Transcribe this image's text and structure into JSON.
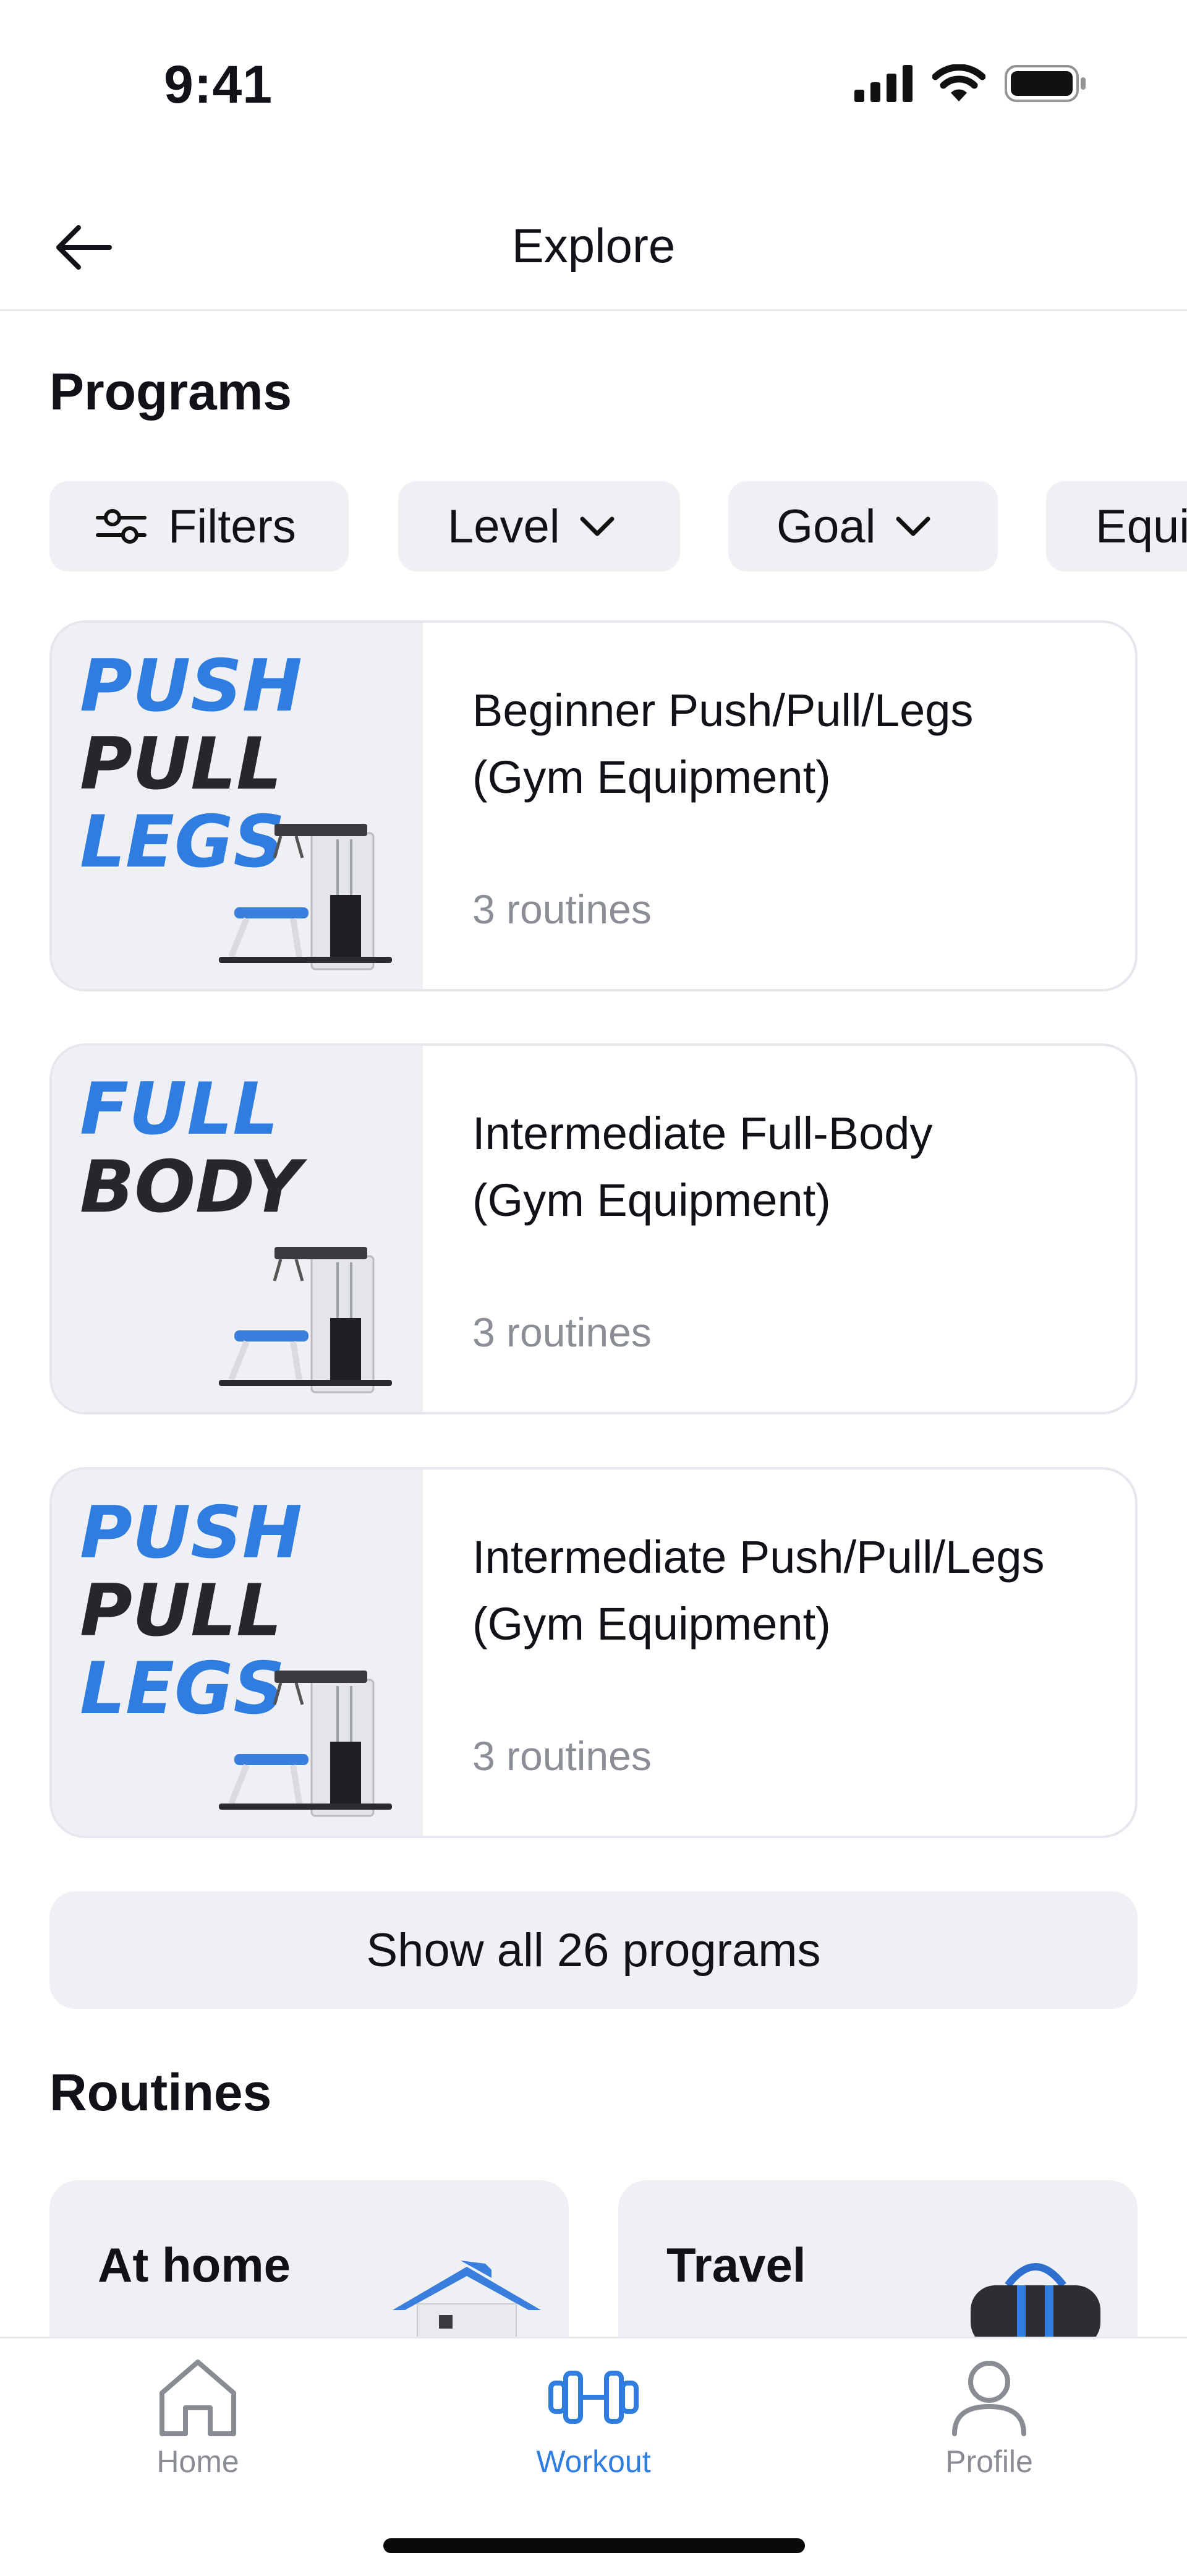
{
  "status_bar": {
    "time": "9:41"
  },
  "header": {
    "title": "Explore"
  },
  "programs": {
    "title": "Programs",
    "chips": [
      {
        "label": "Filters",
        "icon": "sliders-icon"
      },
      {
        "label": "Level",
        "icon": "chevron-down-icon"
      },
      {
        "label": "Goal",
        "icon": "chevron-down-icon"
      },
      {
        "label": "Equi",
        "icon": ""
      }
    ],
    "cards": [
      {
        "title_line1": "Beginner Push/Pull/Legs",
        "title_line2": "(Gym Equipment)",
        "subtitle": "3 routines",
        "thumb_words": [
          "PUSH",
          "PULL",
          "LEGS"
        ]
      },
      {
        "title_line1": "Intermediate Full-Body",
        "title_line2": "(Gym Equipment)",
        "subtitle": "3 routines",
        "thumb_words": [
          "FULL",
          "BODY"
        ]
      },
      {
        "title_line1": "Intermediate Push/Pull/Legs",
        "title_line2": "(Gym Equipment)",
        "subtitle": "3 routines",
        "thumb_words": [
          "PUSH",
          "PULL",
          "LEGS"
        ]
      }
    ],
    "show_all_label": "Show all 26 programs"
  },
  "routines": {
    "title": "Routines",
    "cards": [
      {
        "label": "At home"
      },
      {
        "label": "Travel"
      }
    ]
  },
  "bottom_nav": {
    "items": [
      {
        "label": "Home",
        "active": false
      },
      {
        "label": "Workout",
        "active": true
      },
      {
        "label": "Profile",
        "active": false
      }
    ]
  },
  "colors": {
    "accent": "#2f7de1",
    "chip_bg": "#eef0f4",
    "muted_text": "#8c8e96",
    "inactive_nav": "#8a8c93"
  }
}
